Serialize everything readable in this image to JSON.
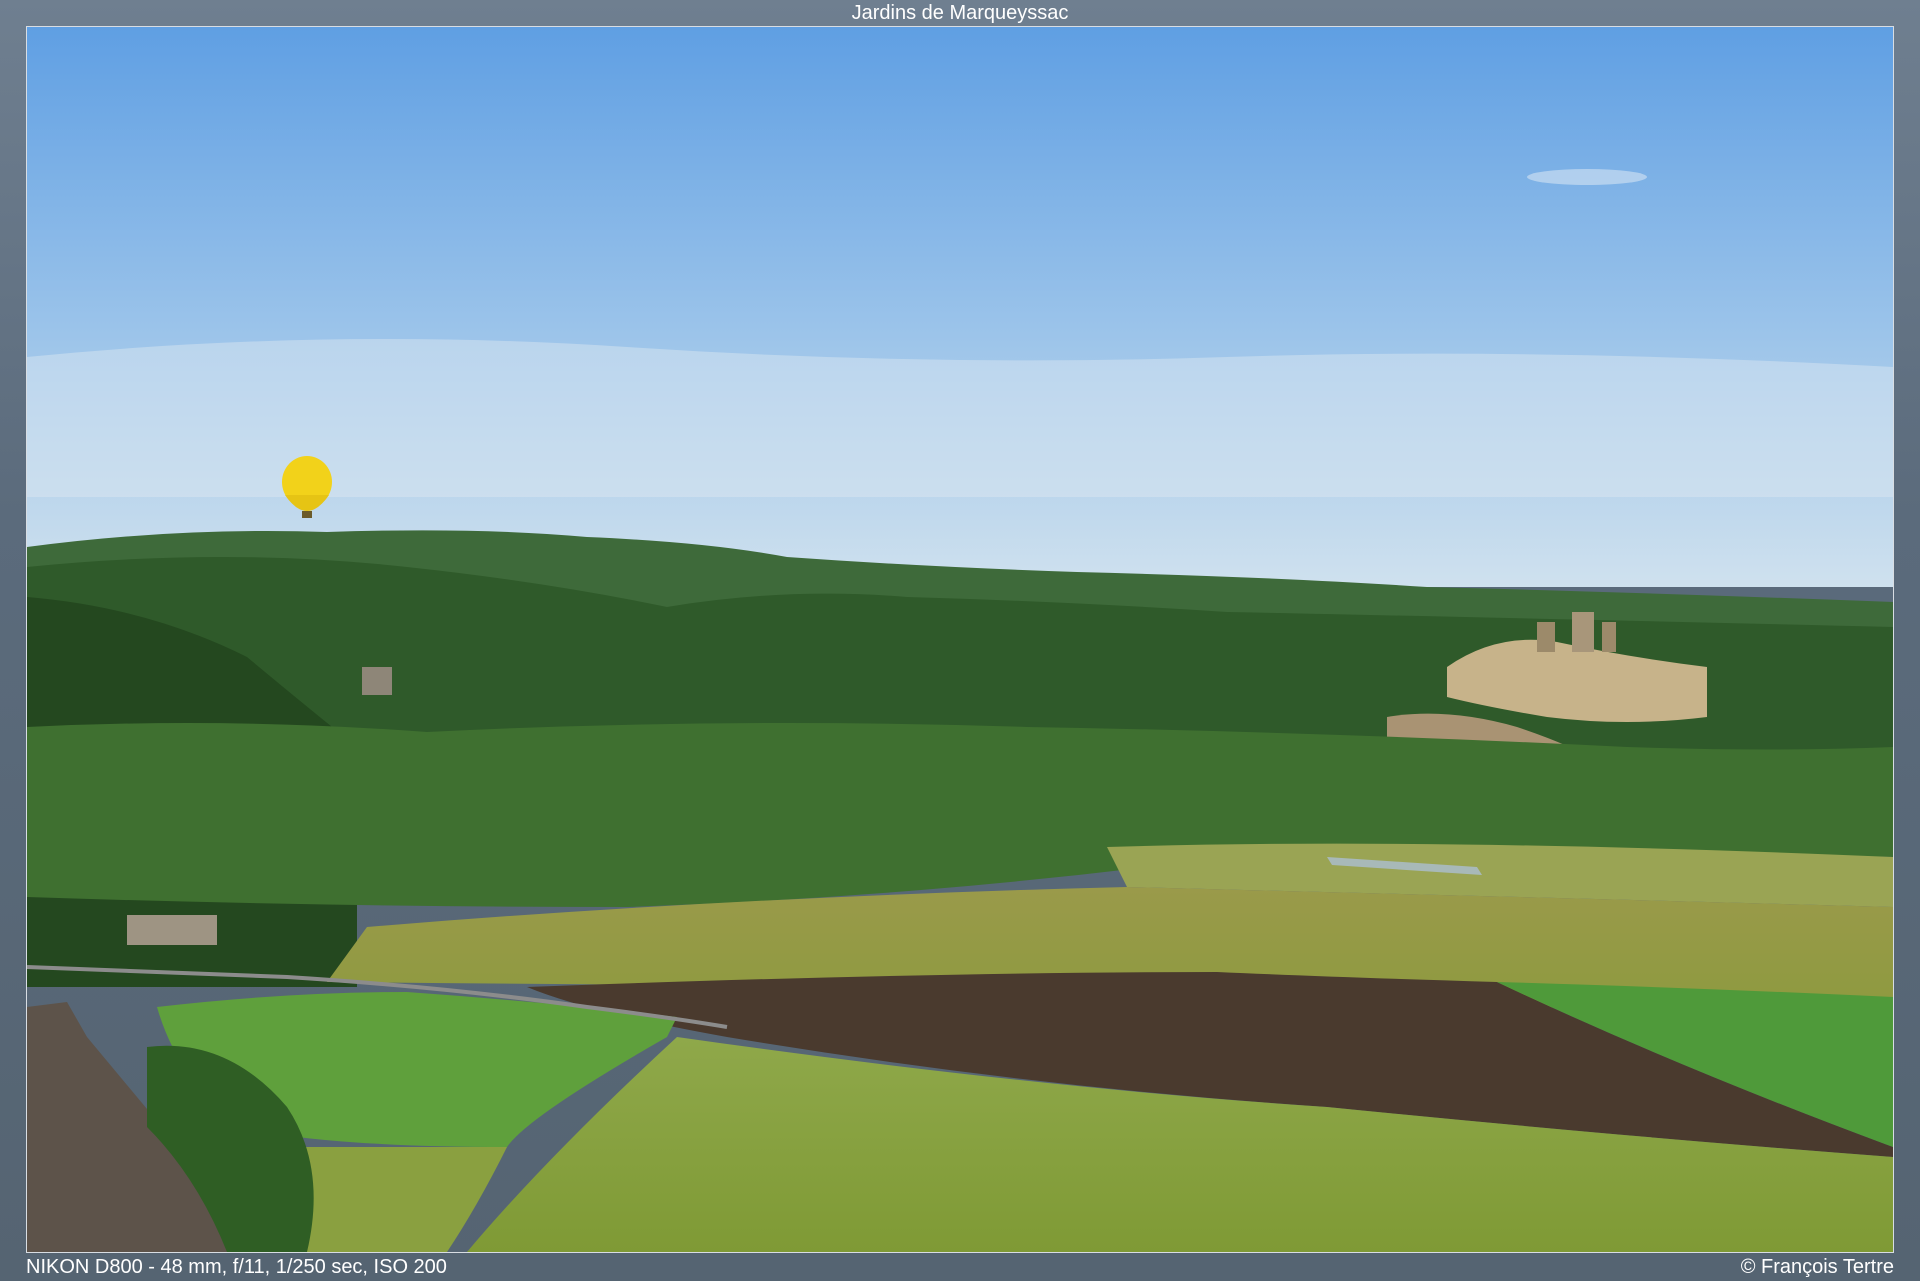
{
  "title": "Jardins de Marqueyssac",
  "exif": "NIKON D800 - 48 mm, f/11, 1/250 sec, ISO 200",
  "copyright": "© François Tertre",
  "colors": {
    "sky_top": "#5f9fe3",
    "sky_bottom": "#cfe1ee",
    "hills": "#2f5a2a",
    "field_light": "#8a9a45",
    "field_green": "#5fa03c",
    "plowed": "#4a3a2e",
    "balloon": "#f2d21a"
  },
  "scene": {
    "description_icons": [
      "hot-air-balloon-icon",
      "castle-icon"
    ]
  }
}
